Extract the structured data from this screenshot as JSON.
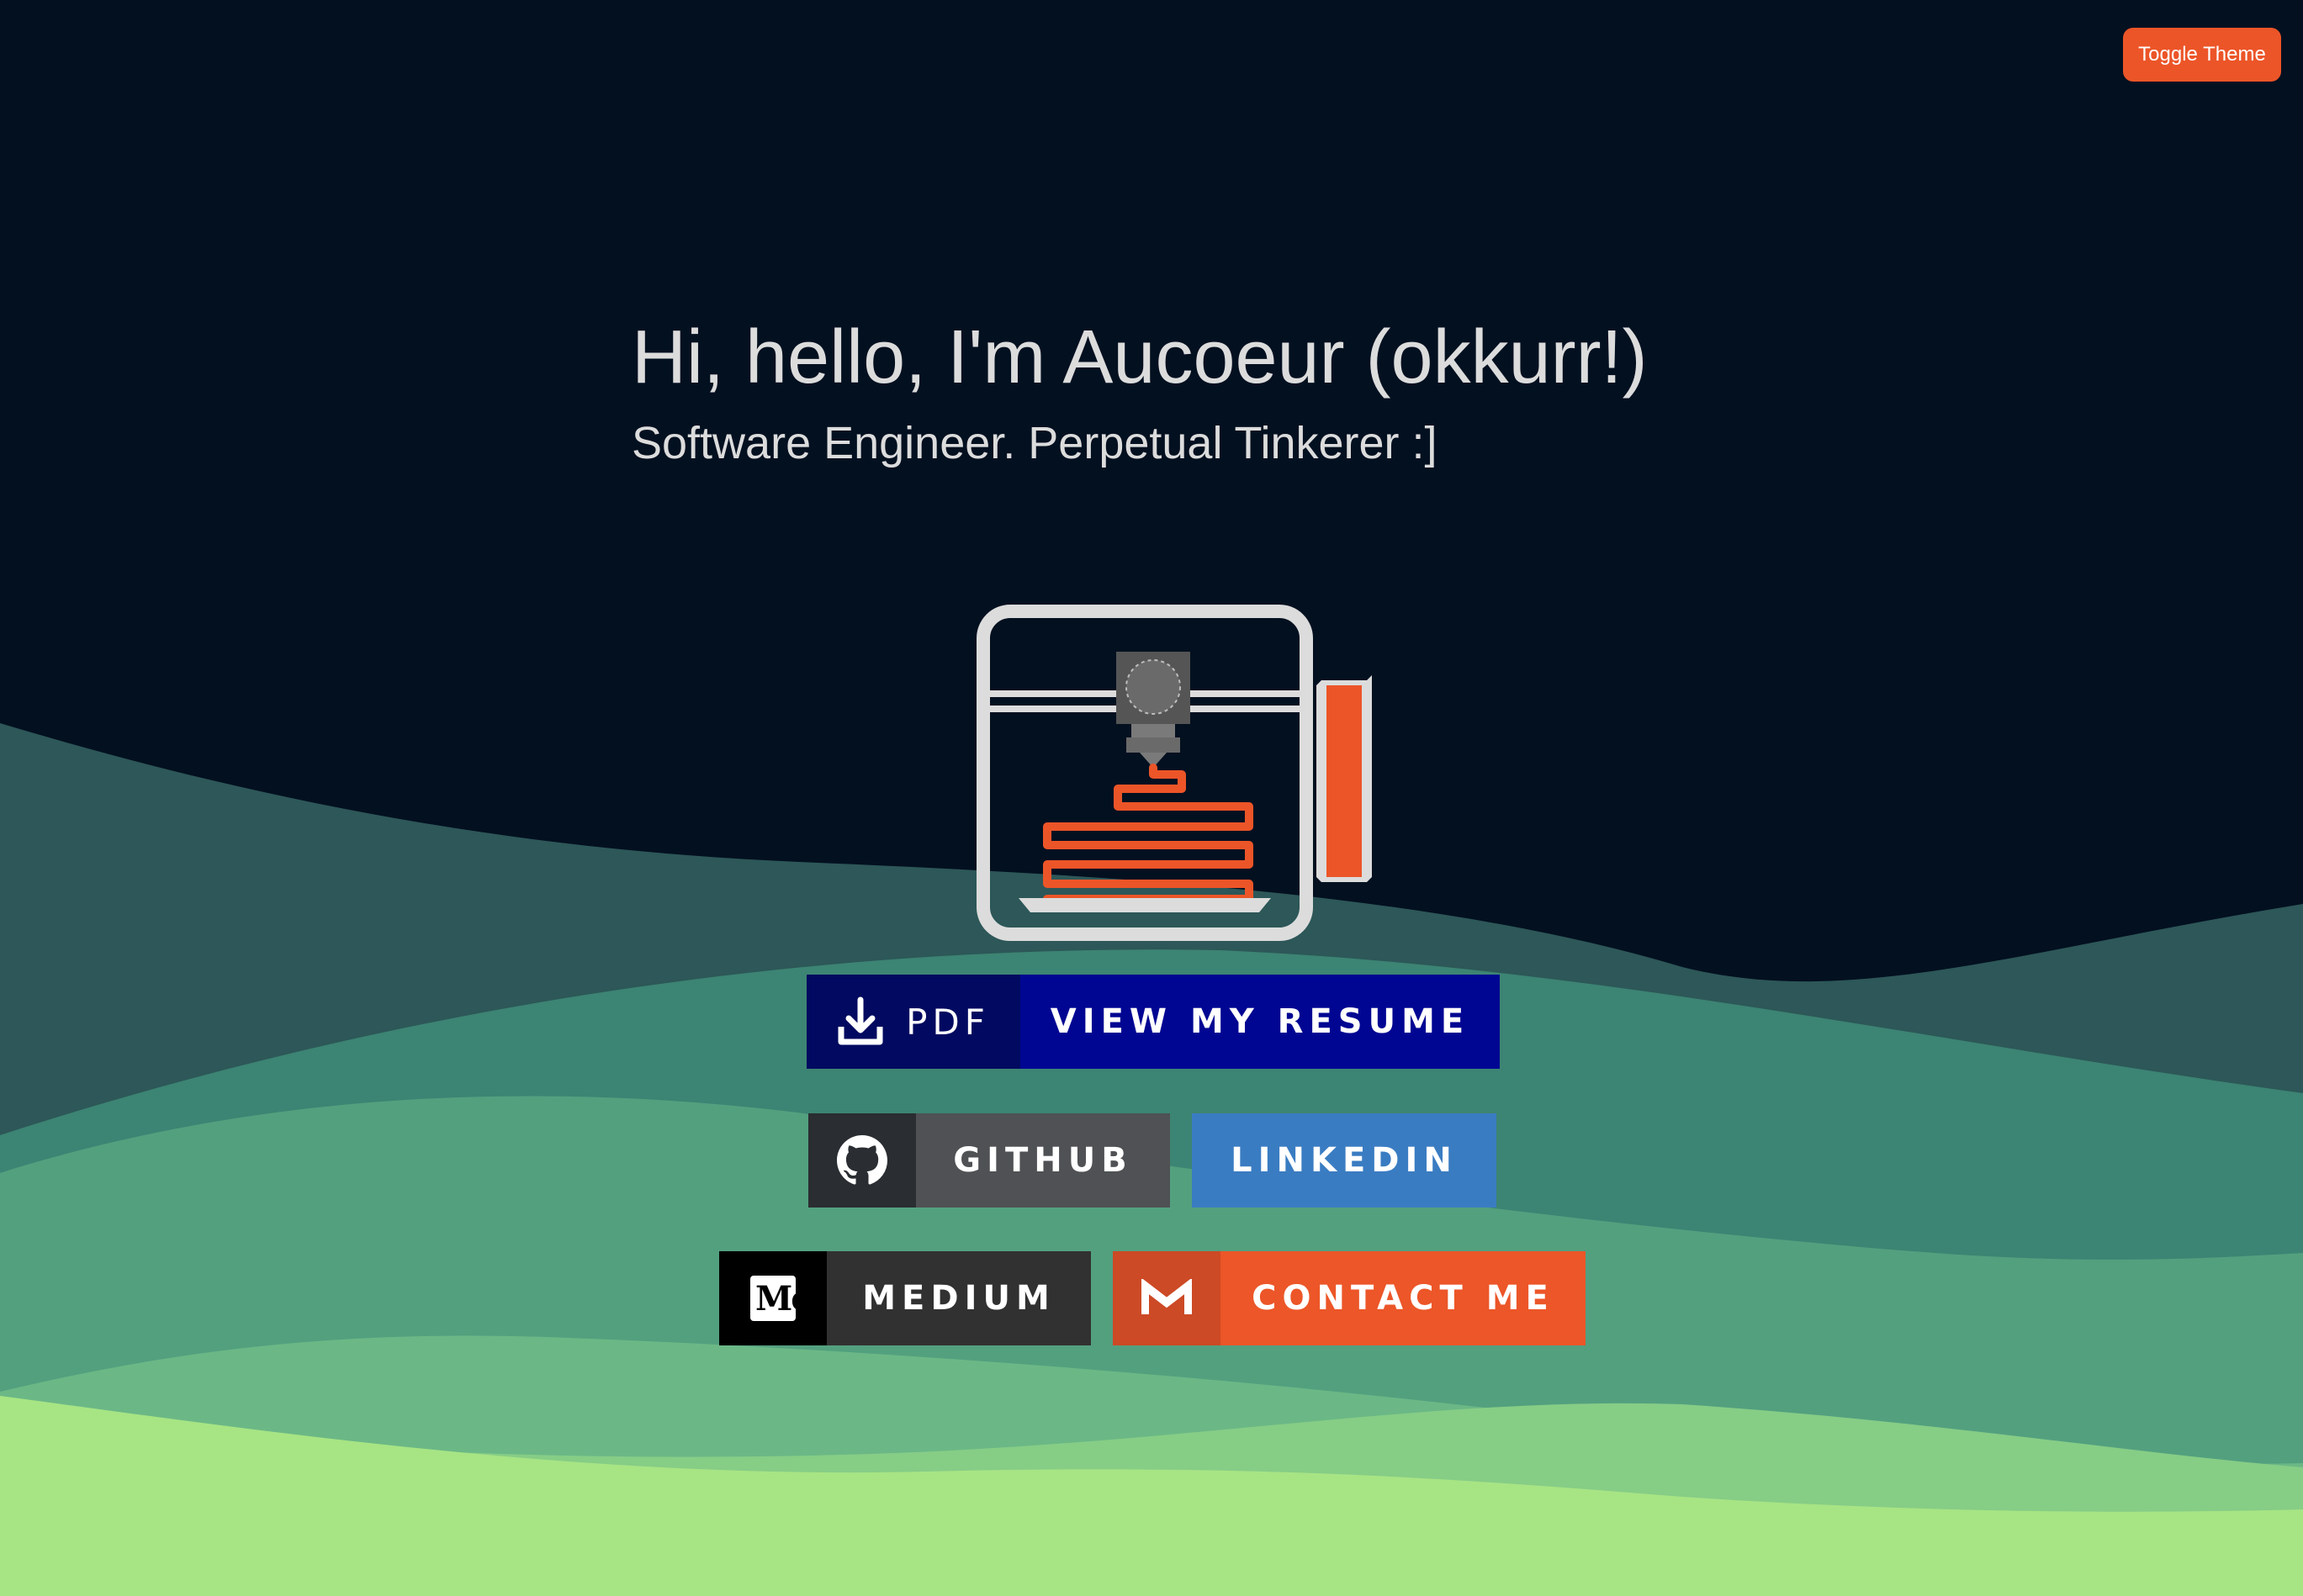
{
  "header": {
    "toggle_label": "Toggle Theme"
  },
  "hero": {
    "title": "Hi, hello, I'm Aucoeur (okkurr!)",
    "subtitle": "Software Engineer. Perpetual Tinkerer :]"
  },
  "illustration": {
    "icon": "3d-printer-icon"
  },
  "buttons": {
    "resume": {
      "badge": "PDF",
      "label": "VIEW MY RESUME",
      "icon": "download-icon",
      "color": "#000692"
    },
    "github": {
      "label": "GITHUB",
      "icon": "github-icon",
      "color": "#4f5154"
    },
    "linkedin": {
      "label": "LINKEDIN",
      "color": "#3a7cc2"
    },
    "medium": {
      "label": "MEDIUM",
      "icon": "medium-icon",
      "logo_text": "Me",
      "color": "#313131"
    },
    "contact": {
      "label": "CONTACT ME",
      "icon": "gmail-icon",
      "color": "#ec5628"
    }
  },
  "theme": {
    "background": "#031020",
    "accent": "#ec5528",
    "text": "#dcdcdc",
    "hills": [
      "#2d5758",
      "#3c8473",
      "#53a07f",
      "#6bb886",
      "#86cd86",
      "#a7e484"
    ]
  }
}
